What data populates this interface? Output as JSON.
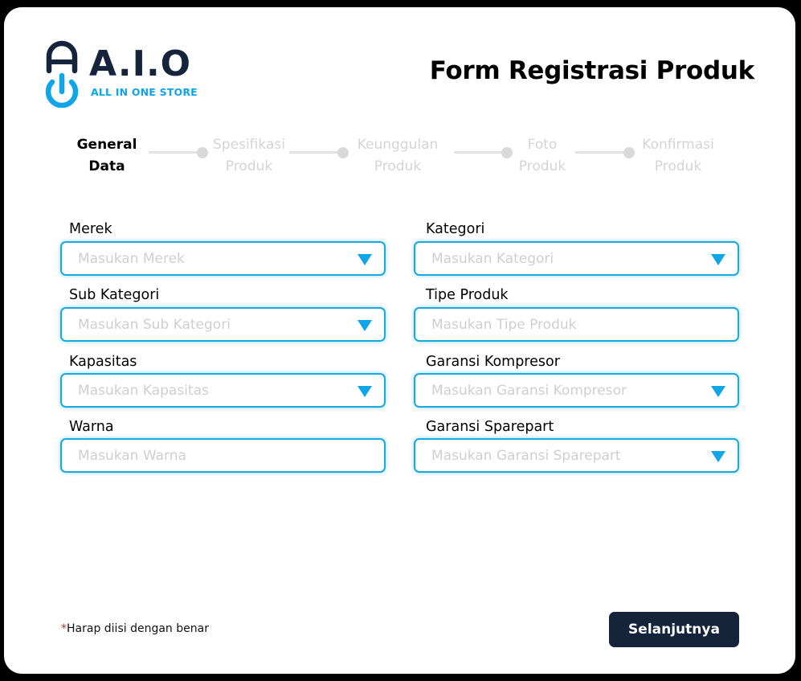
{
  "brand": {
    "logo_text": "A.I.O",
    "tagline": "ALL IN ONE STORE",
    "accent_color": "#0ea5e9",
    "dark_color": "#15233b"
  },
  "page_title": "Form Registrasi Produk",
  "stepper": {
    "steps": [
      {
        "line1": "General",
        "line2": "Data",
        "active": true
      },
      {
        "line1": "Spesifikasi",
        "line2": "Produk",
        "active": false
      },
      {
        "line1": "Keunggulan",
        "line2": "Produk",
        "active": false
      },
      {
        "line1": "Foto",
        "line2": "Produk",
        "active": false
      },
      {
        "line1": "Konfirmasi",
        "line2": "Produk",
        "active": false
      }
    ]
  },
  "form": {
    "merek": {
      "label": "Merek",
      "placeholder": "Masukan Merek",
      "dropdown": true
    },
    "kategori": {
      "label": "Kategori",
      "placeholder": "Masukan Kategori",
      "dropdown": true
    },
    "sub_kategori": {
      "label": "Sub Kategori",
      "placeholder": "Masukan Sub Kategori",
      "dropdown": true
    },
    "tipe_produk": {
      "label": "Tipe Produk",
      "placeholder": "Masukan Tipe Produk",
      "dropdown": false
    },
    "kapasitas": {
      "label": "Kapasitas",
      "placeholder": "Masukan Kapasitas",
      "dropdown": true
    },
    "garansi_kompresor": {
      "label": "Garansi Kompresor",
      "placeholder": "Masukan Garansi Kompresor",
      "dropdown": true
    },
    "warna": {
      "label": "Warna",
      "placeholder": "Masukan Warna",
      "dropdown": false
    },
    "garansi_sparepart": {
      "label": "Garansi Sparepart",
      "placeholder": "Masukan Garansi Sparepart",
      "dropdown": true
    }
  },
  "footer": {
    "required_star": "*",
    "note": "Harap diisi dengan benar",
    "next_label": "Selanjutnya"
  }
}
